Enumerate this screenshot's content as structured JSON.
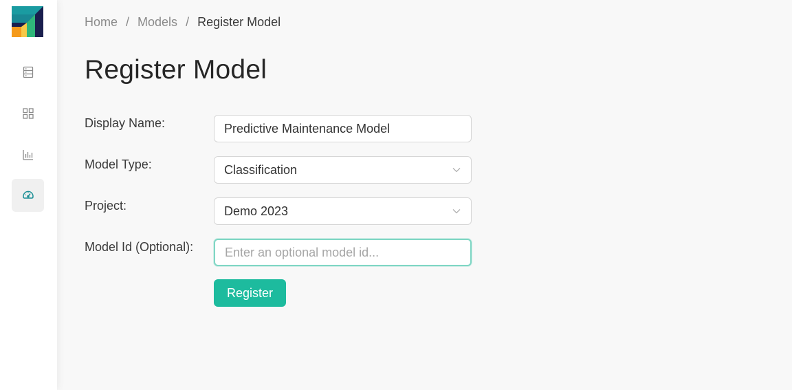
{
  "breadcrumb": {
    "home": "Home",
    "models": "Models",
    "current": "Register Model",
    "separator": "/"
  },
  "page": {
    "title": "Register Model"
  },
  "form": {
    "display_name": {
      "label": "Display Name:",
      "value": "Predictive Maintenance Model"
    },
    "model_type": {
      "label": "Model Type:",
      "value": "Classification"
    },
    "project": {
      "label": "Project:",
      "value": "Demo 2023"
    },
    "model_id": {
      "label": "Model Id (Optional):",
      "value": "",
      "placeholder": "Enter an optional model id..."
    },
    "submit_label": "Register"
  },
  "sidebar": {
    "items": [
      {
        "icon": "server-list-icon",
        "active": false
      },
      {
        "icon": "grid-icon",
        "active": false
      },
      {
        "icon": "bar-chart-icon",
        "active": false
      },
      {
        "icon": "gauge-icon",
        "active": true
      }
    ]
  },
  "colors": {
    "accent": "#1dbb9e",
    "focus_border": "#7fd6c4",
    "logo_dark": "#1a1f4e",
    "logo_teal": "#1a9ba1",
    "logo_green": "#2fb67a",
    "logo_orange": "#f59a1b"
  }
}
